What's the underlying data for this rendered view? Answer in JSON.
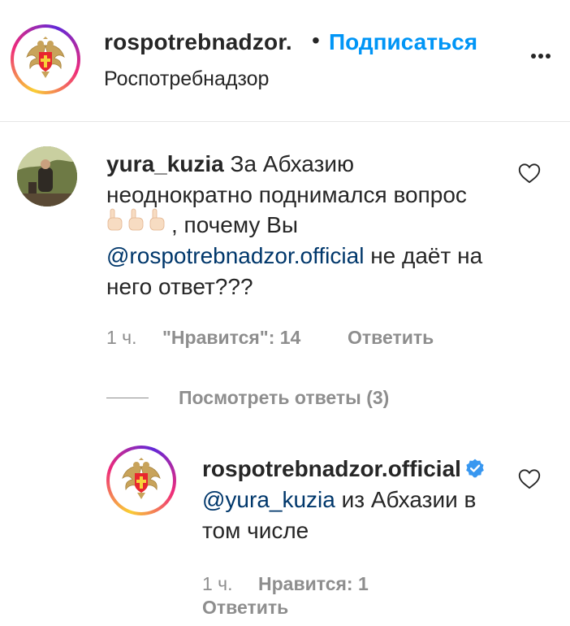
{
  "header": {
    "username": "rospotrebnadzor.",
    "separator": "•",
    "follow_label": "Подписаться",
    "subtitle": "Роспотребнадзор",
    "more_icon": "more-horizontal-icon"
  },
  "comment": {
    "username": "yura_kuzia",
    "text_part1": "За Абхазию неоднократно поднимался вопрос",
    "emoji": "☝️☝️☝️",
    "text_part2": ", почему Вы",
    "mention": "@rospotrebnadzor.official",
    "text_part3": "не даёт на него ответ???",
    "time": "1 ч.",
    "likes_label": "\"Нравится\": 14",
    "reply_label": "Ответить",
    "like_icon": "heart-outline-icon"
  },
  "view_replies": {
    "label": "Посмотреть ответы (3)"
  },
  "reply": {
    "username": "rospotrebnadzor.official",
    "verified_icon": "verified-badge-icon",
    "mention": "@yura_kuzia",
    "text": "из Абхазии в том числе",
    "time": "1 ч.",
    "likes_label": "Нравится: 1",
    "reply_label": "Ответить",
    "like_icon": "heart-outline-icon"
  },
  "colors": {
    "link_blue": "#0095f6",
    "mention_blue": "#00376b",
    "meta_gray": "#8e8e8e",
    "text": "#262626",
    "verified": "#3897f0"
  }
}
